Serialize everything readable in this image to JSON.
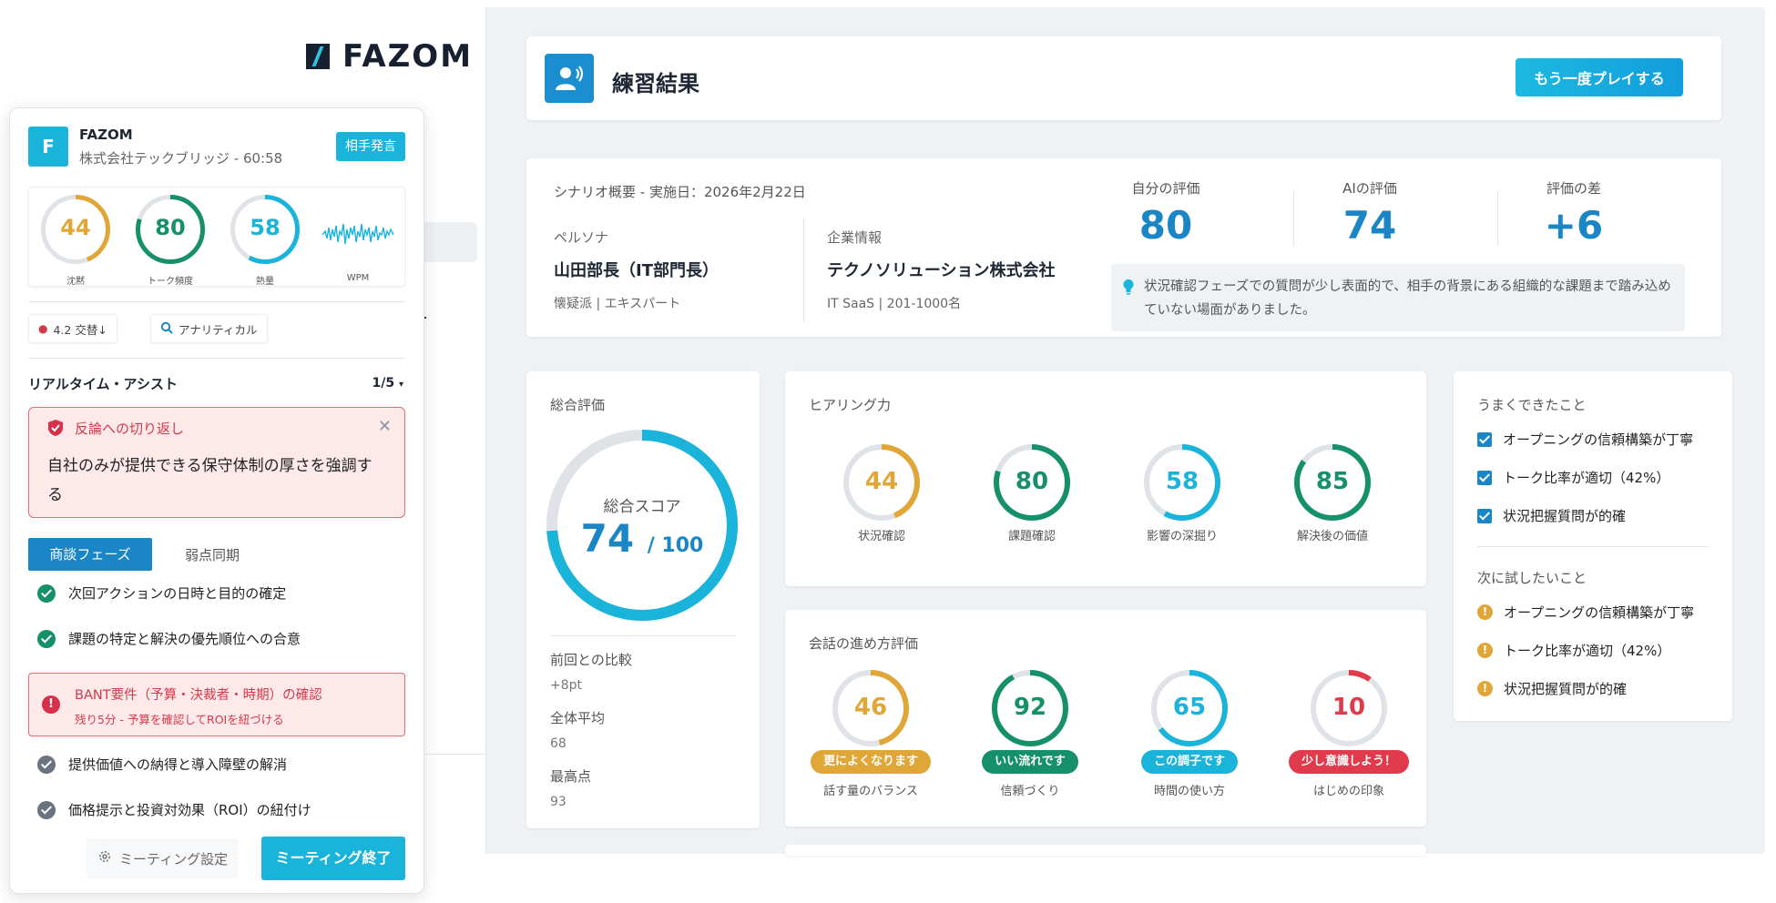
{
  "app": {
    "logo": "FAZOM",
    "header": {
      "title": "練習結果",
      "replay_button": "もう一度プレイする"
    },
    "scenario": {
      "heading": "シナリオ概要 - 実施日：2026年2月22日",
      "persona_label": "ペルソナ",
      "persona_name": "山田部長（IT部門長）",
      "persona_sub": "懐疑派 | エキスパート",
      "company_label": "企業情報",
      "company_name": "テクノソリューション株式会社",
      "company_sub": "IT SaaS | 201-1000名",
      "metrics": [
        {
          "label": "自分の評価",
          "value": "80"
        },
        {
          "label": "AIの評価",
          "value": "74"
        },
        {
          "label": "評価の差",
          "value": "+6"
        }
      ],
      "note": "状況確認フェーズでの質問が少し表面的で、相手の背景にある組織的な課題まで踏み込めていない場面がありました。"
    },
    "overall": {
      "title": "総合評価",
      "caption": "総合スコア",
      "score": "74",
      "score_value": 74,
      "max": "/ 100",
      "stats": [
        {
          "label": "前回との比較",
          "value": "+8pt"
        },
        {
          "label": "全体平均",
          "value": "68"
        },
        {
          "label": "最高点",
          "value": "93"
        }
      ]
    },
    "hearing": {
      "title": "ヒアリング力",
      "gauges": [
        {
          "value": "44",
          "num": 44,
          "label": "状況確認",
          "color": "#e0a637"
        },
        {
          "value": "80",
          "num": 80,
          "label": "課題確認",
          "color": "#15906a"
        },
        {
          "value": "58",
          "num": 58,
          "label": "影響の深掘り",
          "color": "#1ab3d9"
        },
        {
          "value": "85",
          "num": 85,
          "label": "解決後の価値",
          "color": "#15906a"
        }
      ]
    },
    "conversation": {
      "title": "会話の進め方評価",
      "gauges": [
        {
          "value": "46",
          "num": 46,
          "badge": "更によくなります",
          "label": "話す量のバランス",
          "color": "#e0a637"
        },
        {
          "value": "92",
          "num": 92,
          "badge": "いい流れです",
          "label": "信頼づくり",
          "color": "#15906a"
        },
        {
          "value": "65",
          "num": 65,
          "badge": "この調子です",
          "label": "時間の使い方",
          "color": "#1ab3d9"
        },
        {
          "value": "10",
          "num": 10,
          "badge": "少し意識しよう！",
          "label": "はじめの印象",
          "color": "#df3b4d"
        }
      ]
    },
    "good": {
      "title": "うまくできたこと",
      "items": [
        "オープニングの信頼構築が丁寧",
        "トーク比率が適切（42%）",
        "状況把握質問が的確"
      ]
    },
    "next": {
      "title": "次に試したいこと",
      "items": [
        "オープニングの信頼構築が丁寧",
        "トーク比率が適切（42%）",
        "状況把握質問が的確"
      ]
    }
  },
  "panel": {
    "avatar": "F",
    "name": "FAZOM",
    "subtitle": "株式会社テックブリッジ - 60:58",
    "speaker_button": "相手発言",
    "meters": [
      {
        "value": "44",
        "num": 44,
        "label": "沈黙",
        "color": "#e0a637"
      },
      {
        "value": "80",
        "num": 80,
        "label": "トーク頻度",
        "color": "#15906a"
      },
      {
        "value": "58",
        "num": 58,
        "label": "熱量",
        "color": "#1ab3d9"
      }
    ],
    "wpm_label": "WPM",
    "chips": [
      {
        "text": "4.2 交替↓"
      },
      {
        "text": "アナリティカル"
      }
    ],
    "assist_title": "リアルタイム・アシスト",
    "assist_page": "1/5",
    "alert": {
      "title": "反論への切り返し",
      "body": "自社のみが提供できる保守体制の厚さを強調する"
    },
    "tabs": {
      "active": "商談フェーズ",
      "inactive": "弱点同期"
    },
    "tasks": [
      {
        "text": "次回アクションの日時と目的の確定",
        "state": "done"
      },
      {
        "text": "課題の特定と解決の優先順位への合意",
        "state": "done"
      }
    ],
    "task_alert": {
      "title": "BANT要件（予算・決裁者・時期）の確認",
      "sub": "残り5分 - 予算を確認してROIを紐づける"
    },
    "pending_tasks": [
      {
        "text": "提供価値への納得と導入障壁の解消"
      },
      {
        "text": "価格提示と投資対効果（ROI）の紐付け"
      }
    ],
    "settings_button": "ミーティング設定",
    "end_button": "ミーティング終了"
  }
}
